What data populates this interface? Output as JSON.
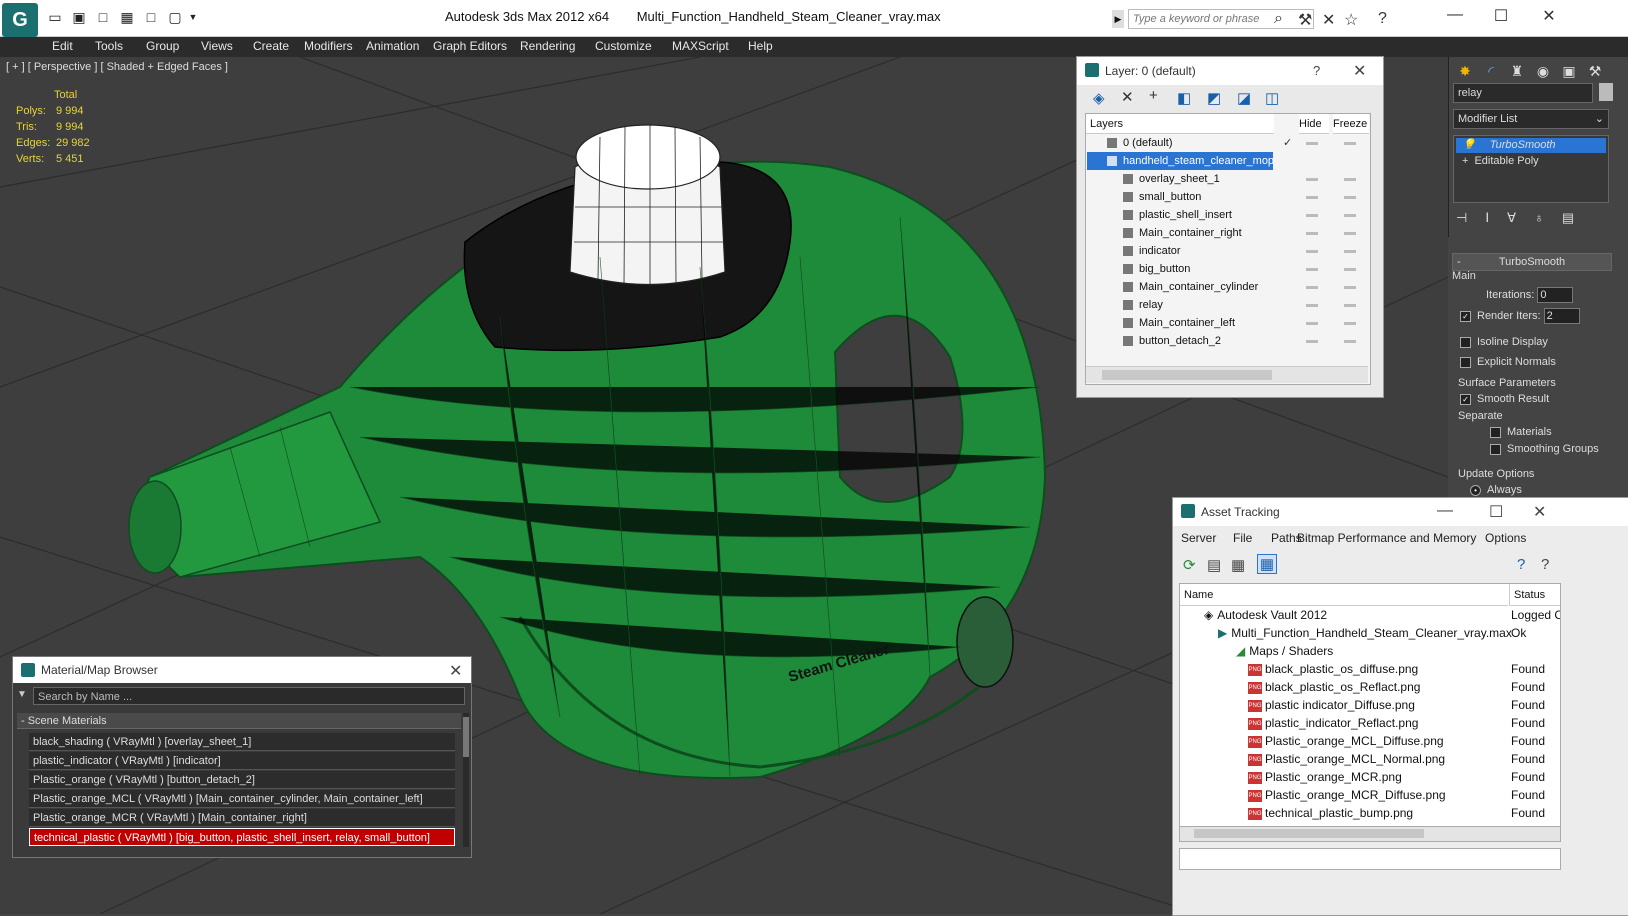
{
  "window": {
    "app": "Autodesk 3ds Max  2012 x64",
    "file": "Multi_Function_Handheld_Steam_Cleaner_vray.max",
    "search_placeholder": "Type a keyword or phrase"
  },
  "menu": [
    "Edit",
    "Tools",
    "Group",
    "Views",
    "Create",
    "Modifiers",
    "Animation",
    "Graph Editors",
    "Rendering",
    "Customize",
    "MAXScript",
    "Help"
  ],
  "viewport": {
    "label": "[ + ] [ Perspective ] [ Shaded + Edged Faces ]",
    "model_text": "Steam Cleaner",
    "stats": {
      "header": "Total",
      "rows": [
        {
          "label": "Polys:",
          "value": "9 994"
        },
        {
          "label": "Tris:",
          "value": "9 994"
        },
        {
          "label": "Edges:",
          "value": "29 982"
        },
        {
          "label": "Verts:",
          "value": "5 451"
        }
      ]
    }
  },
  "layer_panel": {
    "title": "Layer: 0 (default)",
    "help": "?",
    "col_layers": "Layers",
    "col_hide": "Hide",
    "col_freeze": "Freeze",
    "root": "0 (default)",
    "group": "handheld_steam_cleaner_mop",
    "children": [
      "overlay_sheet_1",
      "small_button",
      "plastic_shell_insert",
      "Main_container_right",
      "indicator",
      "big_button",
      "Main_container_cylinder",
      "relay",
      "Main_container_left",
      "button_detach_2"
    ]
  },
  "command_panel": {
    "name_field": "relay",
    "modifier_list": "Modifier List",
    "stack": [
      "TurboSmooth",
      "Editable Poly"
    ],
    "rollout_title": "TurboSmooth",
    "main_label": "Main",
    "iterations_label": "Iterations:",
    "iterations_value": "0",
    "render_iters_label": "Render Iters:",
    "render_iters_value": "2",
    "isoline": "Isoline Display",
    "explicit_normals": "Explicit Normals",
    "surface_params": "Surface Parameters",
    "smooth_result": "Smooth Result",
    "separate": "Separate",
    "materials": "Materials",
    "smoothing_groups": "Smoothing Groups",
    "update_options": "Update Options",
    "always": "Always"
  },
  "asset_tracking": {
    "title": "Asset Tracking",
    "menu": [
      "Server",
      "File",
      "Paths",
      "Bitmap Performance and Memory",
      "Options"
    ],
    "col_name": "Name",
    "col_status": "Status",
    "rows": [
      {
        "name": "Autodesk Vault 2012",
        "status": "Logged C",
        "indent": 1
      },
      {
        "name": "Multi_Function_Handheld_Steam_Cleaner_vray.max",
        "status": "Ok",
        "indent": 2
      },
      {
        "name": "Maps / Shaders",
        "status": "",
        "indent": 3
      },
      {
        "name": "black_plastic_os_diffuse.png",
        "status": "Found",
        "indent": 4
      },
      {
        "name": "black_plastic_os_Reflact.png",
        "status": "Found",
        "indent": 4
      },
      {
        "name": "plastic indicator_Diffuse.png",
        "status": "Found",
        "indent": 4
      },
      {
        "name": "plastic_indicator_Reflact.png",
        "status": "Found",
        "indent": 4
      },
      {
        "name": "Plastic_orange_MCL_Diffuse.png",
        "status": "Found",
        "indent": 4
      },
      {
        "name": "Plastic_orange_MCL_Normal.png",
        "status": "Found",
        "indent": 4
      },
      {
        "name": "Plastic_orange_MCR.png",
        "status": "Found",
        "indent": 4
      },
      {
        "name": "Plastic_orange_MCR_Diffuse.png",
        "status": "Found",
        "indent": 4
      },
      {
        "name": "technical_plastic_bump.png",
        "status": "Found",
        "indent": 4
      }
    ]
  },
  "material_browser": {
    "title": "Material/Map Browser",
    "search_placeholder": "Search by Name ...",
    "section": "- Scene Materials",
    "rows": [
      "black_shading  ( VRayMtl ) [overlay_sheet_1]",
      "plastic_indicator  ( VRayMtl ) [indicator]",
      "Plastic_orange  ( VRayMtl ) [button_detach_2]",
      "Plastic_orange_MCL  ( VRayMtl ) [Main_container_cylinder, Main_container_left]",
      "Plastic_orange_MCR  ( VRayMtl ) [Main_container_right]",
      "technical_plastic  ( VRayMtl ) [big_button, plastic_shell_insert, relay, small_button]"
    ]
  },
  "colors": {
    "model_green": "#1e8b3a",
    "selection_blue": "#2a74d4",
    "stats_yellow": "#e5d43a",
    "highlight_red": "#c00000"
  }
}
